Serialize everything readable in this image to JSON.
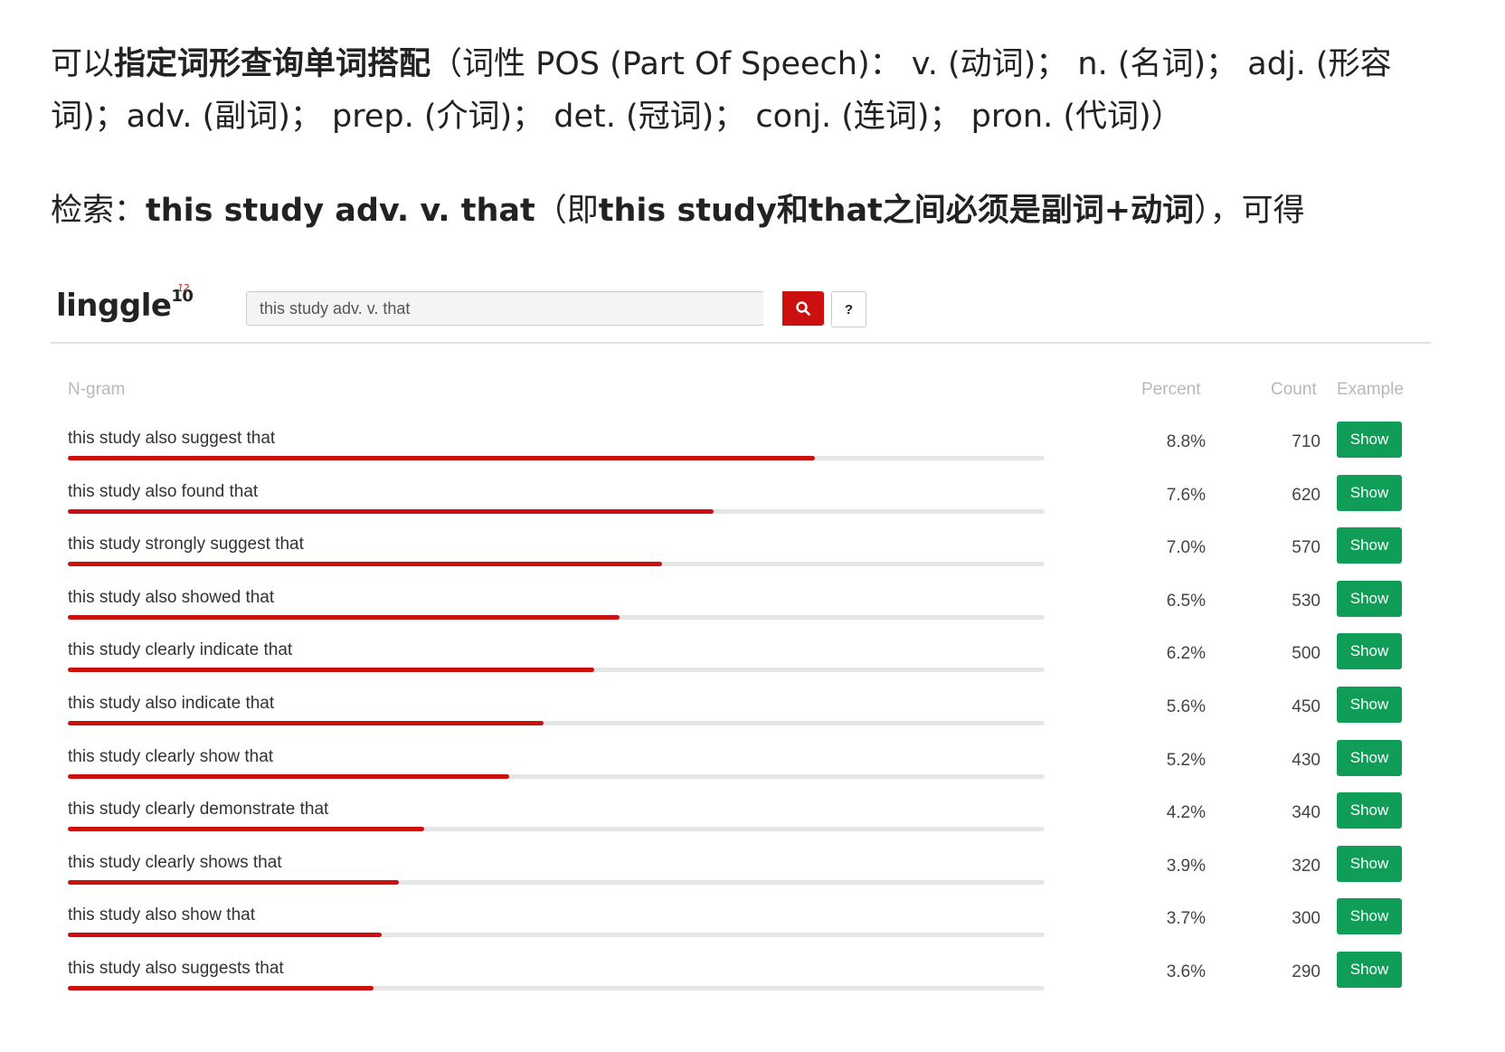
{
  "intro": {
    "prefix": "可以",
    "bold": "指定词形查询单词搭配",
    "line1_rest": "（词性 POS (Part Of Speech)： v. (动词)； n. (名词)； adj. (形容",
    "line2": "词)；adv. (副词)； prep. (介词)； det. (冠词)； conj. (连词)； pron. (代词)）"
  },
  "query_line": {
    "prefix": "检索：",
    "bold1": "this study adv. v. that",
    "paren_open": "（即",
    "bold2": "this study和that之间必须是副词+动词",
    "suffix": "），可得"
  },
  "app": {
    "logo": "linggle",
    "logo_sup": "10",
    "logo_ver": "12",
    "search_value": "this study adv. v. that",
    "help_label": "?",
    "accent_color": "#cc1010",
    "show_color": "#0f9d58"
  },
  "table": {
    "headers": {
      "ngram": "N-gram",
      "percent": "Percent",
      "count": "Count",
      "example": "Example"
    },
    "rows": [
      {
        "ngram": "this study also suggest that",
        "percent": "8.8%",
        "count": "710",
        "fraction": 0.088,
        "action": "Show"
      },
      {
        "ngram": "this study also found that",
        "percent": "7.6%",
        "count": "620",
        "fraction": 0.076,
        "action": "Show"
      },
      {
        "ngram": "this study strongly suggest that",
        "percent": "7.0%",
        "count": "570",
        "fraction": 0.07,
        "action": "Show"
      },
      {
        "ngram": "this study also showed that",
        "percent": "6.5%",
        "count": "530",
        "fraction": 0.065,
        "action": "Show"
      },
      {
        "ngram": "this study clearly indicate that",
        "percent": "6.2%",
        "count": "500",
        "fraction": 0.062,
        "action": "Show"
      },
      {
        "ngram": "this study also indicate that",
        "percent": "5.6%",
        "count": "450",
        "fraction": 0.056,
        "action": "Show"
      },
      {
        "ngram": "this study clearly show that",
        "percent": "5.2%",
        "count": "430",
        "fraction": 0.052,
        "action": "Show"
      },
      {
        "ngram": "this study clearly demonstrate that",
        "percent": "4.2%",
        "count": "340",
        "fraction": 0.042,
        "action": "Show"
      },
      {
        "ngram": "this study clearly shows that",
        "percent": "3.9%",
        "count": "320",
        "fraction": 0.039,
        "action": "Show"
      },
      {
        "ngram": "this study also show that",
        "percent": "3.7%",
        "count": "300",
        "fraction": 0.037,
        "action": "Show"
      },
      {
        "ngram": "this study also suggests that",
        "percent": "3.6%",
        "count": "290",
        "fraction": 0.036,
        "action": "Show"
      }
    ]
  }
}
